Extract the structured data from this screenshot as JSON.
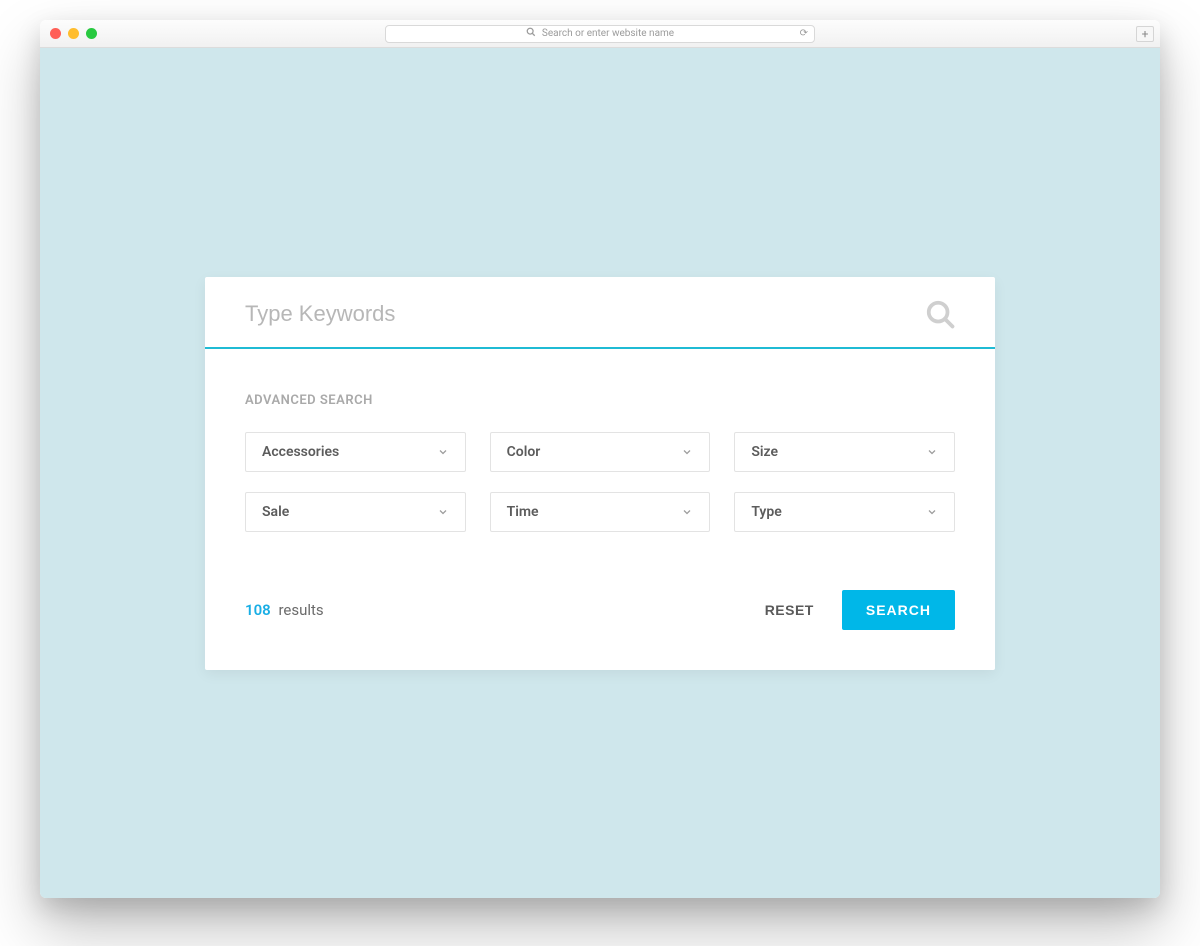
{
  "browser": {
    "url_placeholder": "Search or enter website name"
  },
  "search": {
    "keyword_placeholder": "Type Keywords",
    "section_label": "ADVANCED SEARCH",
    "filters": [
      {
        "label": "Accessories"
      },
      {
        "label": "Color"
      },
      {
        "label": "Size"
      },
      {
        "label": "Sale"
      },
      {
        "label": "Time"
      },
      {
        "label": "Type"
      }
    ],
    "results_count": "108",
    "results_label": "results",
    "reset_label": "RESET",
    "submit_label": "SEARCH"
  },
  "colors": {
    "accent_line": "#1fbbd4",
    "primary_button": "#00b7e8",
    "page_bg": "#cfe7ec"
  }
}
